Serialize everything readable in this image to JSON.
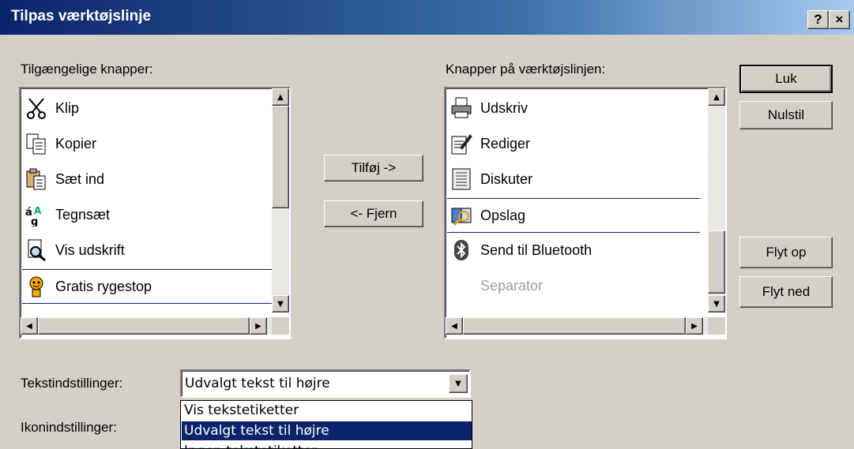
{
  "window": {
    "title": "Tilpas værktøjslinje",
    "help_label": "?",
    "close_label": "×"
  },
  "available": {
    "label": "Tilgængelige knapper:",
    "items": [
      {
        "label": "Klip",
        "icon": "scissors-icon"
      },
      {
        "label": "Kopier",
        "icon": "copy-icon"
      },
      {
        "label": "Sæt ind",
        "icon": "paste-icon"
      },
      {
        "label": "Tegnsæt",
        "icon": "charset-icon"
      },
      {
        "label": "Vis udskrift",
        "icon": "print-preview-icon"
      },
      {
        "label": "Gratis rygestop",
        "icon": "no-smoking-icon"
      }
    ],
    "selected_index": 5
  },
  "current": {
    "label": "Knapper på værktøjslinjen:",
    "items": [
      {
        "label": "Udskriv",
        "icon": "printer-icon"
      },
      {
        "label": "Rediger",
        "icon": "edit-icon"
      },
      {
        "label": "Diskuter",
        "icon": "discuss-icon"
      },
      {
        "label": "Opslag",
        "icon": "lookup-icon"
      },
      {
        "label": "Send til Bluetooth",
        "icon": "bluetooth-icon"
      },
      {
        "label": "Separator",
        "icon": ""
      }
    ],
    "selected_index": 3
  },
  "buttons": {
    "add": "Tilføj ->",
    "remove": "<- Fjern",
    "close": "Luk",
    "reset": "Nulstil",
    "move_up": "Flyt op",
    "move_down": "Flyt ned"
  },
  "text_options": {
    "label": "Tekstindstillinger:",
    "selected": "Udvalgt tekst til højre",
    "options": [
      "Vis tekstetiketter",
      "Udvalgt tekst til højre",
      "Ingen tekstetiketter"
    ]
  },
  "icon_options": {
    "label": "Ikonindstillinger:"
  },
  "colors": {
    "title_start": "#0a246a",
    "title_end": "#a6caf0",
    "selection": "#0a246a",
    "face": "#d4d0c8"
  }
}
